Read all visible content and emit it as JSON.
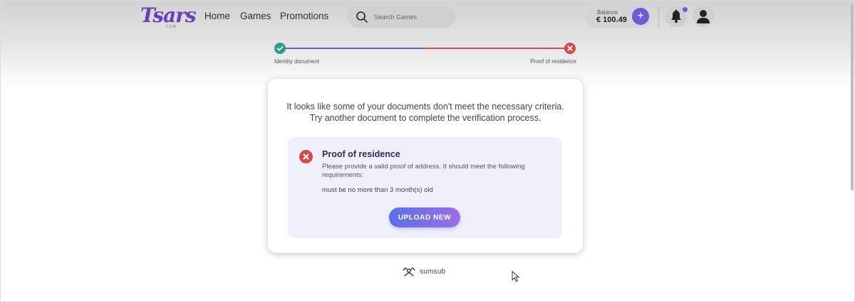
{
  "header": {
    "logo_text": "Tsars",
    "logo_sub": "COM",
    "nav": [
      "Home",
      "Games",
      "Promotions"
    ],
    "search_placeholder": "Search Games",
    "balance_label": "Balance",
    "balance_value": "€ 100.49",
    "add_label": "+"
  },
  "stepper": {
    "steps": [
      {
        "label": "Identity document",
        "status": "complete"
      },
      {
        "label": "Proof of residence",
        "status": "error"
      }
    ]
  },
  "card": {
    "message": "It looks like some of your documents don't meet the necessary criteria. Try another document to complete the verification process.",
    "requirement": {
      "title": "Proof of residence",
      "description": "Please provide a valid proof of address. It should meet the following requirements:",
      "items": [
        "must be no more than 3 month(s) old"
      ],
      "button_label": "UPLOAD NEW"
    }
  },
  "footer": {
    "brand": "sumsub"
  },
  "colors": {
    "accent": "#6b5bd8",
    "success": "#2e9c8a",
    "error": "#d8474f",
    "title": "#2c2b5e"
  },
  "icons": [
    "search-icon",
    "bell-icon",
    "user-avatar-icon",
    "check-icon",
    "close-icon",
    "error-icon",
    "sumsub-logo-icon",
    "cursor-icon"
  ]
}
